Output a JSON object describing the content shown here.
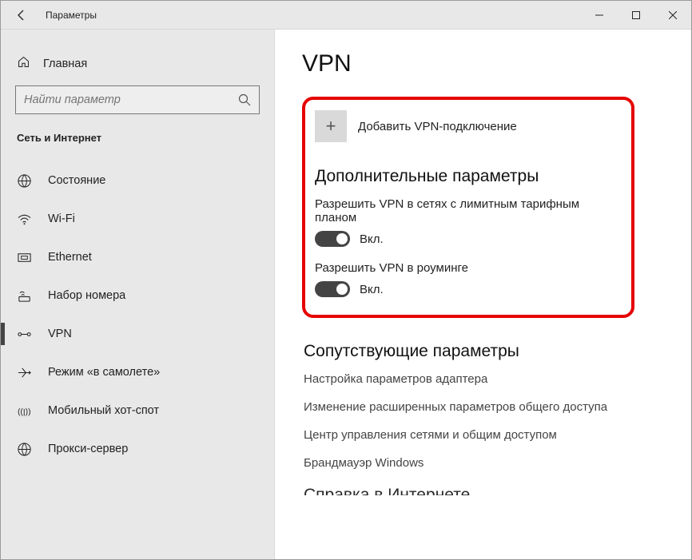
{
  "window": {
    "title": "Параметры"
  },
  "home": {
    "label": "Главная"
  },
  "search": {
    "placeholder": "Найти параметр"
  },
  "section_header": "Сеть и Интернет",
  "nav": {
    "items": [
      {
        "label": "Состояние"
      },
      {
        "label": "Wi-Fi"
      },
      {
        "label": "Ethernet"
      },
      {
        "label": "Набор номера"
      },
      {
        "label": "VPN"
      },
      {
        "label": "Режим «в самолете»"
      },
      {
        "label": "Мобильный хот-спот"
      },
      {
        "label": "Прокси-сервер"
      }
    ]
  },
  "page": {
    "title": "VPN",
    "add_label": "Добавить VPN-подключение",
    "advanced_header": "Дополнительные параметры",
    "opt1_label": "Разрешить VPN в сетях с лимитным тарифным планом",
    "opt1_state": "Вкл.",
    "opt2_label": "Разрешить VPN в роуминге",
    "opt2_state": "Вкл.",
    "related_header": "Сопутствующие параметры",
    "links": [
      "Настройка параметров адаптера",
      "Изменение расширенных параметров общего доступа",
      "Центр управления сетями и общим доступом",
      "Брандмауэр Windows"
    ],
    "cutoff_text": "Справка в Интернете"
  }
}
